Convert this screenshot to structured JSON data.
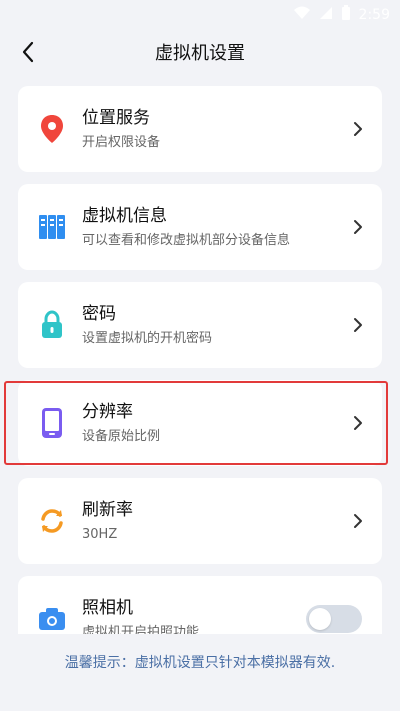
{
  "status_bar": {
    "time": "2:59"
  },
  "header": {
    "title": "虚拟机设置"
  },
  "items": [
    {
      "title": "位置服务",
      "subtitle": "开启权限设备"
    },
    {
      "title": "虚拟机信息",
      "subtitle": "可以查看和修改虚拟机部分设备信息"
    },
    {
      "title": "密码",
      "subtitle": "设置虚拟机的开机密码"
    },
    {
      "title": "分辨率",
      "subtitle": "设备原始比例"
    },
    {
      "title": "刷新率",
      "subtitle": "30HZ"
    },
    {
      "title": "照相机",
      "subtitle": "虚拟机开启拍照功能",
      "toggle_on": false
    }
  ],
  "colors": {
    "location": "#f0463c",
    "info": "#2f8ef0",
    "lock": "#2fc4c8",
    "phone": "#7a5cf0",
    "refresh": "#f59a23",
    "camera": "#3a8ef0",
    "highlight": "#e23a3a"
  },
  "icons": [
    "location-pin-icon",
    "server-info-icon",
    "lock-icon",
    "phone-icon",
    "refresh-icon",
    "camera-icon"
  ],
  "tip": "温馨提示：虚拟机设置只针对本模拟器有效."
}
